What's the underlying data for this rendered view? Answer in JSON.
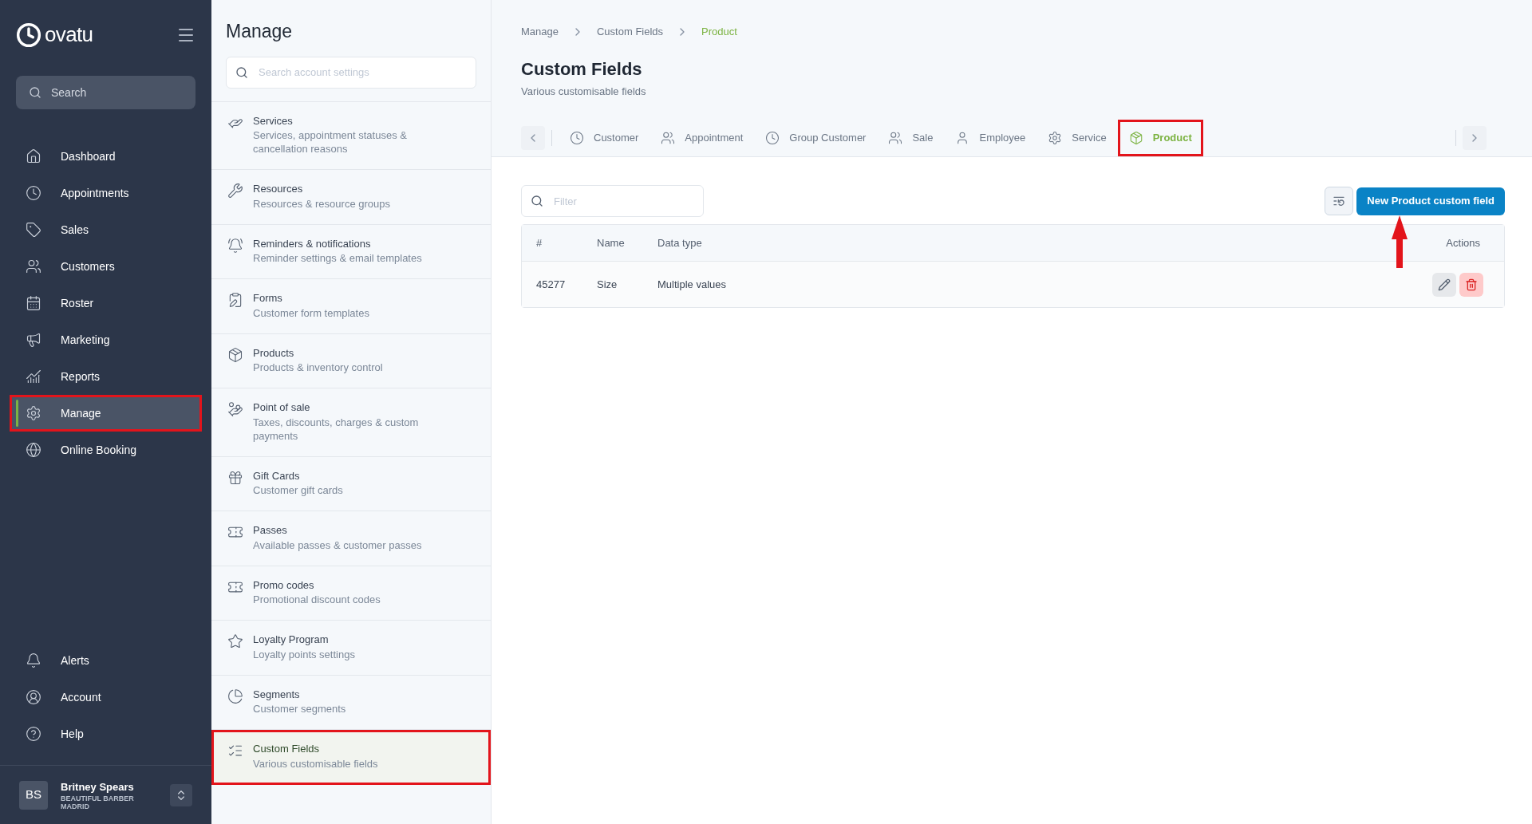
{
  "sidebar": {
    "logo": "ovatu",
    "search": {
      "placeholder": "Search"
    },
    "items": [
      {
        "label": "Dashboard",
        "selected": false,
        "annotated": false
      },
      {
        "label": "Appointments",
        "selected": false,
        "annotated": false
      },
      {
        "label": "Sales",
        "selected": false,
        "annotated": false
      },
      {
        "label": "Customers",
        "selected": false,
        "annotated": false
      },
      {
        "label": "Roster",
        "selected": false,
        "annotated": false
      },
      {
        "label": "Marketing",
        "selected": false,
        "annotated": false
      },
      {
        "label": "Reports",
        "selected": false,
        "annotated": false
      },
      {
        "label": "Manage",
        "selected": true,
        "annotated": true
      },
      {
        "label": "Online Booking",
        "selected": false,
        "annotated": false
      }
    ],
    "bottom_items": [
      {
        "label": "Alerts"
      },
      {
        "label": "Account"
      },
      {
        "label": "Help"
      }
    ],
    "user": {
      "initials": "BS",
      "name": "Britney Spears",
      "business": "BEAUTIFUL BARBER MADRID"
    }
  },
  "settings_panel": {
    "title": "Manage",
    "search": {
      "placeholder": "Search account settings"
    },
    "items": [
      {
        "title": "Services",
        "description": "Services, appointment statuses & cancellation reasons",
        "selected": false,
        "annotated": false
      },
      {
        "title": "Resources",
        "description": "Resources & resource groups",
        "selected": false,
        "annotated": false
      },
      {
        "title": "Reminders & notifications",
        "description": "Reminder settings & email templates",
        "selected": false,
        "annotated": false
      },
      {
        "title": "Forms",
        "description": "Customer form templates",
        "selected": false,
        "annotated": false
      },
      {
        "title": "Products",
        "description": "Products & inventory control",
        "selected": false,
        "annotated": false
      },
      {
        "title": "Point of sale",
        "description": "Taxes, discounts, charges & custom payments",
        "selected": false,
        "annotated": false
      },
      {
        "title": "Gift Cards",
        "description": "Customer gift cards",
        "selected": false,
        "annotated": false
      },
      {
        "title": "Passes",
        "description": "Available passes & customer passes",
        "selected": false,
        "annotated": false
      },
      {
        "title": "Promo codes",
        "description": "Promotional discount codes",
        "selected": false,
        "annotated": false
      },
      {
        "title": "Loyalty Program",
        "description": "Loyalty points settings",
        "selected": false,
        "annotated": false
      },
      {
        "title": "Segments",
        "description": "Customer segments",
        "selected": false,
        "annotated": false
      },
      {
        "title": "Custom Fields",
        "description": "Various customisable fields",
        "selected": true,
        "annotated": true
      }
    ]
  },
  "main": {
    "breadcrumb": [
      "Manage",
      "Custom Fields",
      "Product"
    ],
    "title": "Custom Fields",
    "subtitle": "Various customisable fields",
    "tabs": [
      {
        "label": "Customer",
        "selected": false,
        "annotated": false
      },
      {
        "label": "Appointment",
        "selected": false,
        "annotated": false
      },
      {
        "label": "Group Customer",
        "selected": false,
        "annotated": false
      },
      {
        "label": "Sale",
        "selected": false,
        "annotated": false
      },
      {
        "label": "Employee",
        "selected": false,
        "annotated": false
      },
      {
        "label": "Service",
        "selected": false,
        "annotated": false
      },
      {
        "label": "Product",
        "selected": true,
        "annotated": true
      }
    ],
    "filter": {
      "placeholder": "Filter"
    },
    "new_button": "New Product custom field",
    "table": {
      "columns": [
        "#",
        "Name",
        "Data type",
        "Actions"
      ],
      "rows": [
        {
          "cells": [
            "45277",
            "Size",
            "Multiple values"
          ]
        }
      ]
    }
  }
}
